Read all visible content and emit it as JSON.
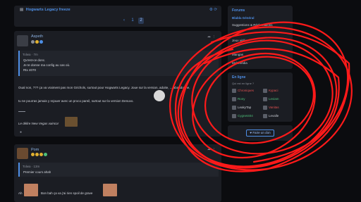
{
  "breadcrumb": {
    "icon": "folder-icon",
    "label": "Hogwarts Legacy freeze",
    "tools": "⚙ ⟳"
  },
  "pagination": {
    "prev": "‹",
    "pages": [
      "1",
      "2"
    ],
    "current": "2"
  },
  "posts": [
    {
      "author": "Aspeth",
      "tools": "➦ ⋮",
      "quote": {
        "author": "Tolwa",
        "time": "7m",
        "lines": [
          "Qu'est-ce donc.",
          "Je te donne ma config au cas où.",
          "Rtx 4070"
        ]
      },
      "body": [
        "Oual non, ??? ça va vraiment pas mon Grichols, surtout pour Hogwarts Legacy. Joue sur la version, adoite, ... abandonne,",
        "tu ne pourras jamais y rejouer avec un proco pareil, surtout sur la version Denuvo."
      ],
      "separator": "___",
      "signature": "Le délire New Vegas vaincor"
    },
    {
      "author": "Pom",
      "tools": "➦ ⋮",
      "quote": {
        "author": "Tolwa",
        "time": "13m",
        "lines": [
          "Premier cours ahah"
        ]
      },
      "body": [
        "Ah",
        "Bon bah ça va j'ai rien spoil de grave"
      ]
    }
  ],
  "sidebar": {
    "forums_title": "Forums",
    "forums": [
      "Blabla Général",
      "Suggestions & Réclamations",
      "Jeux vidéo",
      "Mangas",
      "Multimédia"
    ],
    "forums_active": "Blabla Général",
    "online_title": "En ligne",
    "online_sub": "Qui est en ligne ?",
    "online_users": [
      {
        "name": "Chroniques",
        "color": "#e05050"
      },
      {
        "name": "Kypaci",
        "color": "#e05050"
      },
      {
        "name": "Rony",
        "color": "#4ec07a"
      },
      {
        "name": "Leviam",
        "color": "#4ec07a"
      },
      {
        "name": "LeakyTap",
        "color": "#c9ccd4"
      },
      {
        "name": "Vanitas",
        "color": "#e05050"
      },
      {
        "name": "Cygnet404",
        "color": "#4ec07a"
      },
      {
        "name": "Levalle",
        "color": "#c9ccd4"
      }
    ],
    "donate_label": "♥ Faire un don"
  },
  "colors": {
    "accent": "#4e8fe6",
    "background": "#0b0c0f",
    "card": "#1b1d23",
    "scribble": "#ff1a1a"
  }
}
